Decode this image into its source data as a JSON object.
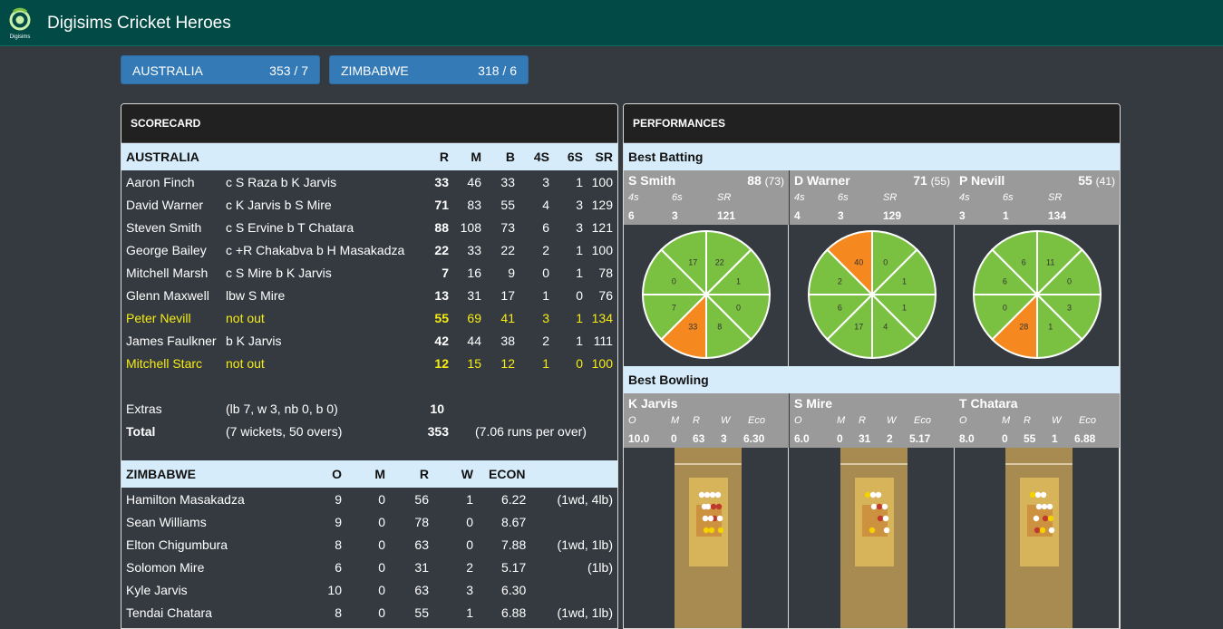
{
  "app": {
    "title": "Digisims Cricket Heroes",
    "logo_text": "Digisims"
  },
  "teams": [
    {
      "name": "AUSTRALIA",
      "score": "353 / 7"
    },
    {
      "name": "ZIMBABWE",
      "score": "318 / 6"
    }
  ],
  "scorecard": {
    "title": "SCORECARD",
    "batting_team": "AUSTRALIA",
    "batting_headers": [
      "R",
      "M",
      "B",
      "4S",
      "6S",
      "SR"
    ],
    "batsmen": [
      {
        "name": "Aaron Finch",
        "dismissal": "c S Raza b K Jarvis",
        "r": "33",
        "m": "46",
        "b": "33",
        "fours": "3",
        "sixes": "1",
        "sr": "100",
        "highlight": false
      },
      {
        "name": "David Warner",
        "dismissal": "c K Jarvis b S Mire",
        "r": "71",
        "m": "83",
        "b": "55",
        "fours": "4",
        "sixes": "3",
        "sr": "129",
        "highlight": false
      },
      {
        "name": "Steven Smith",
        "dismissal": "c S Ervine b T Chatara",
        "r": "88",
        "m": "108",
        "b": "73",
        "fours": "6",
        "sixes": "3",
        "sr": "121",
        "highlight": false
      },
      {
        "name": "George Bailey",
        "dismissal": "c +R Chakabva b H Masakadza",
        "r": "22",
        "m": "33",
        "b": "22",
        "fours": "2",
        "sixes": "1",
        "sr": "100",
        "highlight": false
      },
      {
        "name": "Mitchell Marsh",
        "dismissal": "c S Mire b K Jarvis",
        "r": "7",
        "m": "16",
        "b": "9",
        "fours": "0",
        "sixes": "1",
        "sr": "78",
        "highlight": false
      },
      {
        "name": "Glenn Maxwell",
        "dismissal": "lbw S Mire",
        "r": "13",
        "m": "31",
        "b": "17",
        "fours": "1",
        "sixes": "0",
        "sr": "76",
        "highlight": false
      },
      {
        "name": "Peter Nevill",
        "dismissal": "not out",
        "r": "55",
        "m": "69",
        "b": "41",
        "fours": "3",
        "sixes": "1",
        "sr": "134",
        "highlight": true
      },
      {
        "name": "James Faulkner",
        "dismissal": "b K Jarvis",
        "r": "42",
        "m": "44",
        "b": "38",
        "fours": "2",
        "sixes": "1",
        "sr": "111",
        "highlight": false
      },
      {
        "name": "Mitchell Starc",
        "dismissal": "not out",
        "r": "12",
        "m": "15",
        "b": "12",
        "fours": "1",
        "sixes": "0",
        "sr": "100",
        "highlight": true
      }
    ],
    "extras": {
      "label": "Extras",
      "detail": "(lb 7, w 3, nb 0, b 0)",
      "value": "10"
    },
    "total": {
      "label": "Total",
      "detail": "(7 wickets, 50 overs)",
      "value": "353",
      "rate": "(7.06 runs per over)"
    },
    "bowling_team": "ZIMBABWE",
    "bowling_headers": [
      "O",
      "M",
      "R",
      "W",
      "ECON"
    ],
    "bowlers": [
      {
        "name": "Hamilton Masakadza",
        "o": "9",
        "m": "0",
        "r": "56",
        "w": "1",
        "econ": "6.22",
        "extras": "(1wd, 4lb)"
      },
      {
        "name": "Sean Williams",
        "o": "9",
        "m": "0",
        "r": "78",
        "w": "0",
        "econ": "8.67",
        "extras": ""
      },
      {
        "name": "Elton Chigumbura",
        "o": "8",
        "m": "0",
        "r": "63",
        "w": "0",
        "econ": "7.88",
        "extras": "(1wd, 1lb)"
      },
      {
        "name": "Solomon Mire",
        "o": "6",
        "m": "0",
        "r": "31",
        "w": "2",
        "econ": "5.17",
        "extras": "(1lb)"
      },
      {
        "name": "Kyle Jarvis",
        "o": "10",
        "m": "0",
        "r": "63",
        "w": "3",
        "econ": "6.30",
        "extras": ""
      },
      {
        "name": "Tendai Chatara",
        "o": "8",
        "m": "0",
        "r": "55",
        "w": "1",
        "econ": "6.88",
        "extras": "(1wd, 1lb)"
      }
    ]
  },
  "performances": {
    "title": "PERFORMANCES",
    "best_batting_label": "Best Batting",
    "best_bowling_label": "Best Bowling",
    "batting_stat_labels": [
      "4s",
      "6s",
      "SR"
    ],
    "bowling_stat_labels": [
      "O",
      "M",
      "R",
      "W",
      "Eco"
    ],
    "batting_cards": [
      {
        "name": "S Smith",
        "runs": "88",
        "balls": "(73)",
        "fours": "6",
        "sixes": "3",
        "sr": "121",
        "wagon": [
          "22",
          "1",
          "0",
          "8",
          "33",
          "7",
          "0",
          "17"
        ]
      },
      {
        "name": "D Warner",
        "runs": "71",
        "balls": "(55)",
        "fours": "4",
        "sixes": "3",
        "sr": "129",
        "wagon": [
          "0",
          "1",
          "1",
          "4",
          "17",
          "6",
          "2",
          "40"
        ]
      },
      {
        "name": "P Nevill",
        "runs": "55",
        "balls": "(41)",
        "fours": "3",
        "sixes": "1",
        "sr": "134",
        "wagon": [
          "11",
          "0",
          "3",
          "1",
          "28",
          "0",
          "6",
          "6"
        ]
      }
    ],
    "bowling_cards": [
      {
        "name": "K Jarvis",
        "o": "10.0",
        "m": "0",
        "r": "63",
        "w": "3",
        "eco": "6.30"
      },
      {
        "name": "S Mire",
        "o": "6.0",
        "m": "0",
        "r": "31",
        "w": "2",
        "eco": "5.17"
      },
      {
        "name": "T Chatara",
        "o": "8.0",
        "m": "0",
        "r": "55",
        "w": "1",
        "eco": "6.88"
      }
    ],
    "colors": {
      "wagon_green": "#7ac142",
      "wagon_orange": "#f5891f",
      "pitch": "#a78b50",
      "pitch_strip": "#d7b35a"
    }
  }
}
